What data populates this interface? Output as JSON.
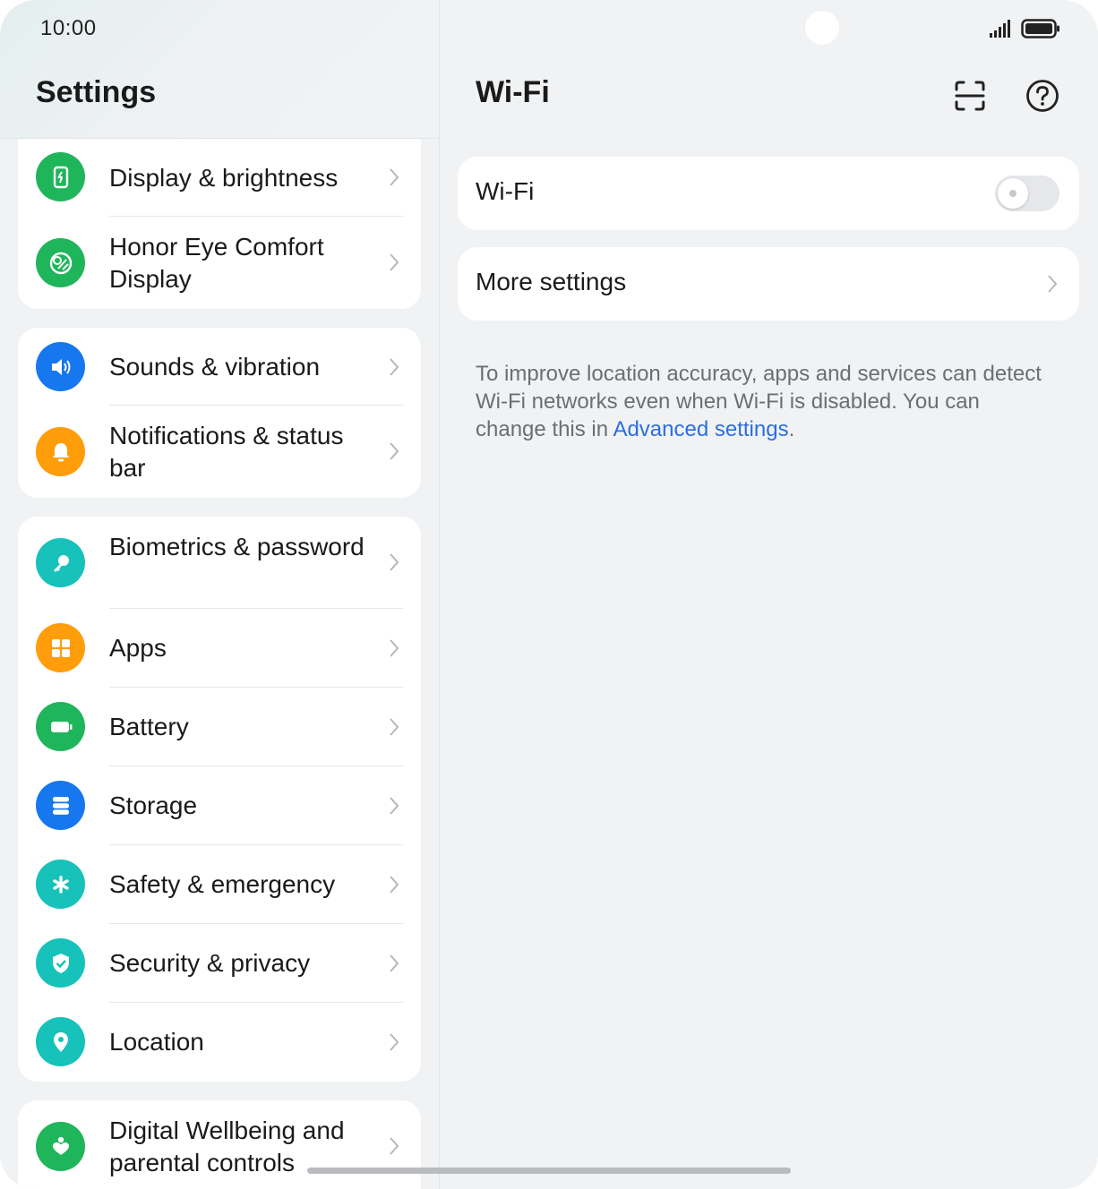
{
  "status_bar": {
    "time": "10:00",
    "signal_icon": "signal-icon",
    "battery_icon": "battery-icon"
  },
  "left": {
    "title": "Settings",
    "items": [
      {
        "label": "Display & brightness",
        "icon": "display-brightness-icon",
        "color": "#1fb55a"
      },
      {
        "label": "Honor Eye Comfort Display",
        "icon": "eye-comfort-icon",
        "color": "#1fb55a"
      },
      {
        "label": "Sounds & vibration",
        "icon": "speaker-icon",
        "color": "#1677ee"
      },
      {
        "label": "Notifications & status bar",
        "icon": "bell-icon",
        "color": "#ff9d0a"
      },
      {
        "label": "Biometrics & password",
        "icon": "key-icon",
        "color": "#16c2b9"
      },
      {
        "label": "Apps",
        "icon": "apps-grid-icon",
        "color": "#ff9d0a"
      },
      {
        "label": "Battery",
        "icon": "battery-item-icon",
        "color": "#1fb55a"
      },
      {
        "label": "Storage",
        "icon": "storage-icon",
        "color": "#1677ee"
      },
      {
        "label": "Safety & emergency",
        "icon": "asterisk-icon",
        "color": "#16c2b9"
      },
      {
        "label": "Security & privacy",
        "icon": "shield-icon",
        "color": "#16c2b9"
      },
      {
        "label": "Location",
        "icon": "location-pin-icon",
        "color": "#16c2b9"
      },
      {
        "label": "Digital Wellbeing and parental controls",
        "icon": "wellbeing-icon",
        "color": "#1fb55a"
      }
    ]
  },
  "right": {
    "title": "Wi-Fi",
    "scan_icon": "scan-icon",
    "help_icon": "help-icon",
    "wifi_label": "Wi-Fi",
    "wifi_enabled": false,
    "more_settings_label": "More settings",
    "note_text": "To improve location accuracy, apps and services can detect Wi-Fi networks even when Wi-Fi is disabled. You can change this in ",
    "note_link": "Advanced settings",
    "note_end": ".",
    "link_color": "#2a6fe0"
  }
}
